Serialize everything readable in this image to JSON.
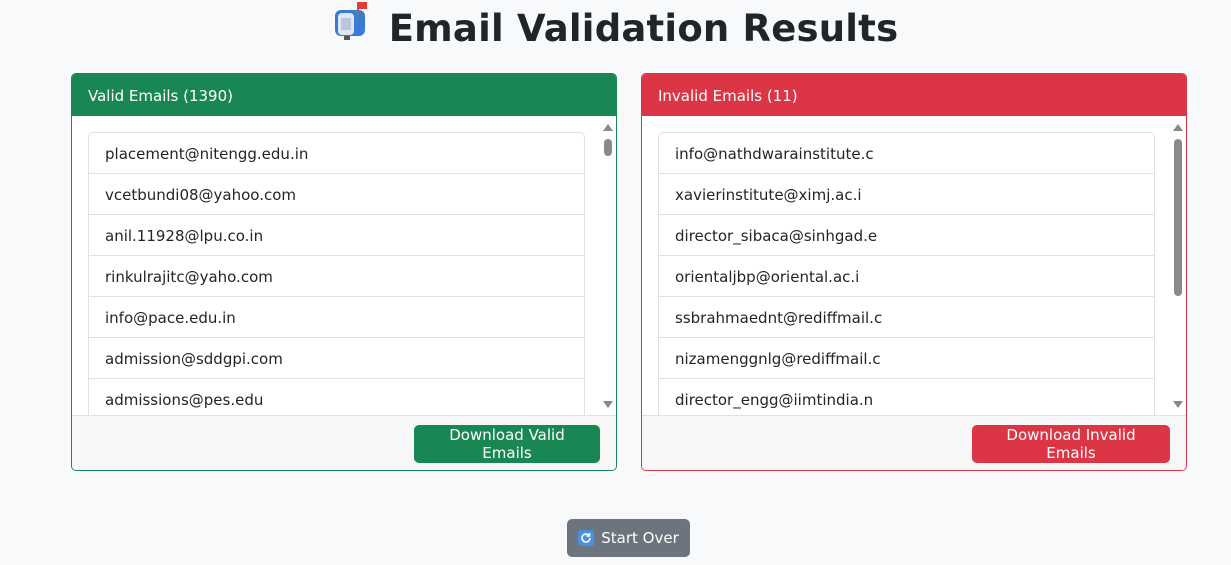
{
  "header": {
    "title": "Email Validation Results",
    "icon": "mailbox-icon"
  },
  "valid_card": {
    "title": "Valid Emails (1390)",
    "color": "#198754",
    "items": [
      "placement@nitengg.edu.in",
      "vcetbundi08@yahoo.com",
      "anil.11928@lpu.co.in",
      "rinkulrajitc@yaho.com",
      "info@pace.edu.in",
      "admission@sddgpi.com",
      "admissions@pes.edu"
    ],
    "download_label": "Download Valid Emails"
  },
  "invalid_card": {
    "title": "Invalid Emails (11)",
    "color": "#dc3545",
    "items": [
      "info@nathdwarainstitute.c",
      "xavierinstitute@ximj.ac.i",
      "director_sibaca@sinhgad.e",
      "orientaljbp@oriental.ac.i",
      "ssbrahmaednt@rediffmail.c",
      "nizamenggnlg@rediffmail.c",
      "director_engg@iimtindia.n"
    ],
    "download_label": "Download Invalid Emails"
  },
  "start_over": {
    "label": "Start Over",
    "icon": "refresh-icon",
    "color": "#6c757d"
  }
}
